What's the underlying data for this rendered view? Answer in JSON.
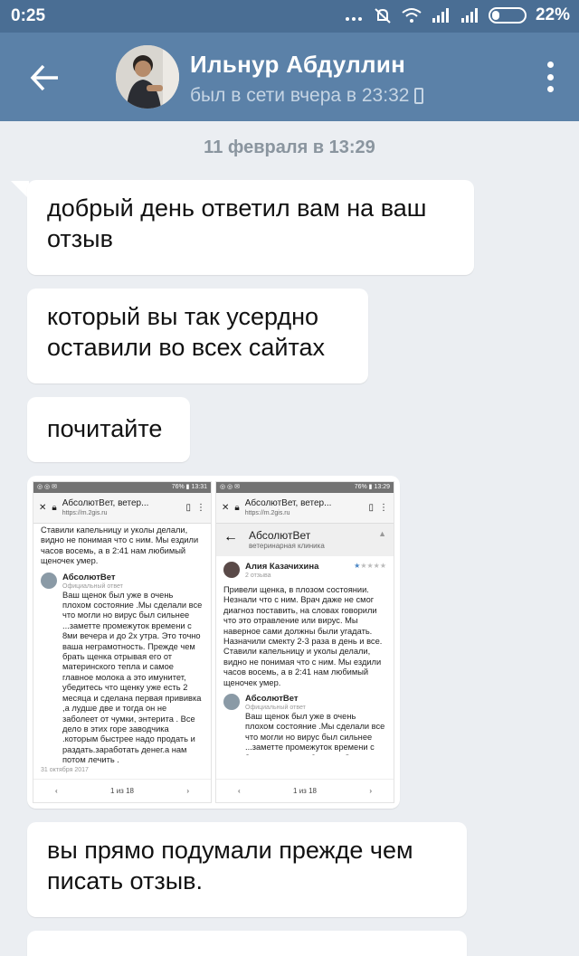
{
  "status_bar": {
    "time": "0:25",
    "battery": "22%"
  },
  "header": {
    "name": "Ильнур Абдуллин",
    "last_seen": "был в сети вчера в 23:32"
  },
  "date_divider": "11 февраля в 13:29",
  "messages": [
    {
      "text": "добрый день ответил вам на ваш отзыв"
    },
    {
      "text": "который вы так усердно оставили во всех сайтах"
    },
    {
      "text": "почитайте"
    },
    {
      "text": "вы прямо подумали прежде чем писать отзыв."
    }
  ],
  "image_message": {
    "left": {
      "status_time": "13:31",
      "status_batt": "76%",
      "title": "АбсолютВет, ветер...",
      "url": "https://m.2gis.ru",
      "top_text": "Ставили капельницу и уколы делали, видно не понимая что с ним. Мы ездили часов восемь, а в 2:41 нам любимый щеночек умер.",
      "author": "АбсолютВет",
      "author_sub": "Официальный ответ",
      "reply": "Ваш щенок был уже в очень плохом состояние .Мы сделали все что могли но вирус был сильнее ...заметте промежуток времени с 8ми вечера и до 2х утра. Это точно ваша неграмотность. Прежде чем брать щенка отрывая его от материнского тепла и самое главное молока а это имунитет, убедитесь что щенку уже есть 2 месяца и сделана первая прививка ,а лудше две и тогда он не заболеет от чумки, энтерита . Все дело в этих горе заводчика .которым быстрее надо продать и раздать.заработать денег.а нам потом лечить .",
      "date": "31 октября 2017",
      "pager": "1 из 18"
    },
    "right": {
      "status_time": "13:29",
      "status_batt": "76%",
      "title": "АбсолютВет, ветер...",
      "url": "https://m.2gis.ru",
      "org_title": "АбсолютВет",
      "org_sub": "ветеринарная клиника",
      "reviewer": "Алия Казачихина",
      "reviewer_sub": "2 отзыва",
      "review": "Привели щенка, в плозом состоянии. Незнали что с ним. Врач даже не смог диагноз поставить, на словах говорили что это отравление или вирус. Мы наверное сами должны были угадать. Назначили смекту 2-3 раза в день и все. Ставили капельницу и уколы делали, видно не понимая что с ним. Мы ездили часов восемь, а в 2:41 нам любимый щеночек умер.",
      "author": "АбсолютВет",
      "author_sub": "Официальный ответ",
      "reply": "Ваш щенок был уже в очень плохом состояние .Мы сделали все что могли но вирус был сильнее ...заметте промежуток времени с 8ми вечера и до 2х утра. Это точно ваша неграмотность. Прежде чем",
      "pager": "1 из 18"
    }
  }
}
